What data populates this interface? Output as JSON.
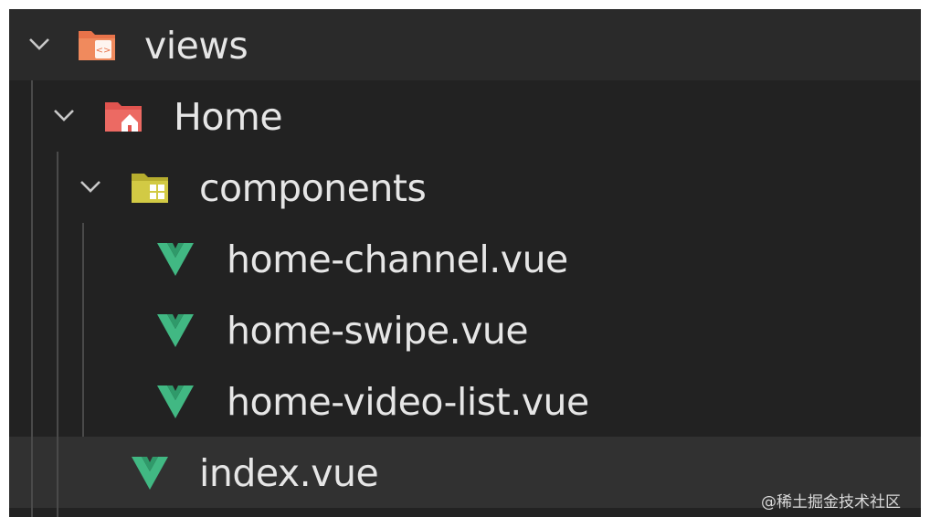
{
  "explorer": {
    "items": [
      {
        "label": "views",
        "kind": "folder",
        "icon": "views-folder-icon",
        "expanded": true
      },
      {
        "label": "Home",
        "kind": "folder",
        "icon": "home-folder-icon",
        "expanded": true
      },
      {
        "label": "components",
        "kind": "folder",
        "icon": "components-folder-icon",
        "expanded": true
      },
      {
        "label": "home-channel.vue",
        "kind": "file",
        "icon": "vue-file-icon"
      },
      {
        "label": "home-swipe.vue",
        "kind": "file",
        "icon": "vue-file-icon"
      },
      {
        "label": "home-video-list.vue",
        "kind": "file",
        "icon": "vue-file-icon"
      },
      {
        "label": "index.vue",
        "kind": "file",
        "icon": "vue-file-icon",
        "selected": true
      }
    ]
  },
  "watermark": {
    "text": "@稀土掘金技术社区"
  },
  "colors": {
    "background": "#222222",
    "row_highlight": "#2a2a2a",
    "selected_row": "#313131",
    "text": "#e6e6e6",
    "vue_green": "#41b883",
    "views_folder": "#e8734a",
    "home_folder": "#e0544f",
    "components_folder": "#c8c13a"
  }
}
